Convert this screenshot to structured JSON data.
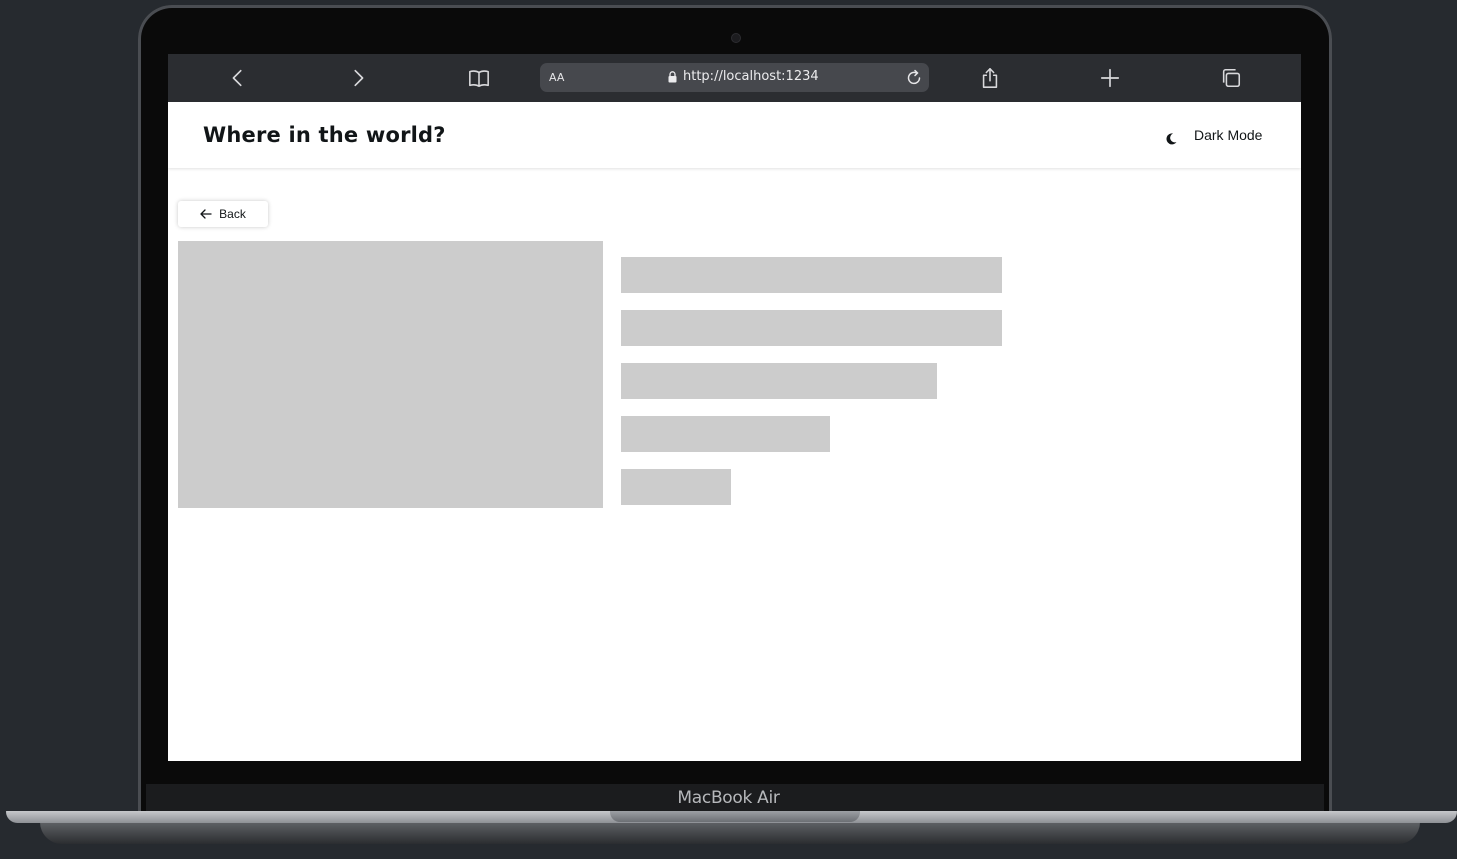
{
  "browser": {
    "text_size_label": "AA",
    "url": "http://localhost:1234"
  },
  "app": {
    "title": "Where in the world?",
    "theme_toggle_label": "Dark Mode",
    "back_label": "Back"
  },
  "device": {
    "label": "MacBook Air"
  },
  "icons": {
    "toolbar": [
      "chevron-left-icon",
      "chevron-right-icon",
      "book-icon",
      "lock-icon",
      "reload-icon",
      "share-icon",
      "plus-icon",
      "tabs-icon"
    ],
    "header": [
      "moon-icon"
    ],
    "back": "arrow-left-icon"
  },
  "colors": {
    "toolbar_bg": "#2b2d31",
    "address_bg": "#46484d",
    "skeleton": "#cccccc",
    "text": "#111517"
  }
}
